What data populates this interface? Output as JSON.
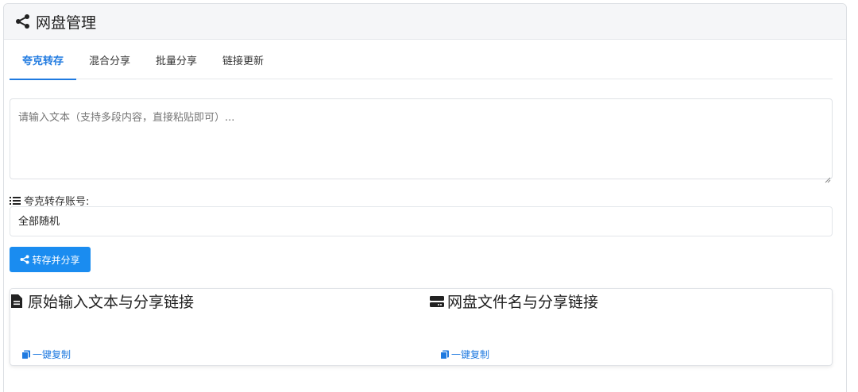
{
  "header": {
    "title": "网盘管理",
    "icon": "share-icon"
  },
  "tabs": [
    {
      "label": "夸克转存",
      "active": true
    },
    {
      "label": "混合分享",
      "active": false
    },
    {
      "label": "批量分享",
      "active": false
    },
    {
      "label": "链接更新",
      "active": false
    }
  ],
  "input": {
    "placeholder": "请输入文本（支持多段内容，直接粘贴即可）...",
    "value": ""
  },
  "account": {
    "label": "夸克转存账号:",
    "selected": "全部随机",
    "icon": "list-icon"
  },
  "action_button": {
    "label": "转存并分享",
    "icon": "share-icon"
  },
  "results": {
    "left": {
      "title": "原始输入文本与分享链接",
      "icon": "file-icon",
      "copy_label": "一键复制"
    },
    "right": {
      "title": "网盘文件名与分享链接",
      "icon": "server-icon",
      "copy_label": "一键复制"
    }
  },
  "colors": {
    "accent": "#1f7ae0",
    "button": "#1a8cf0",
    "header_bg": "#f5f6f8"
  }
}
